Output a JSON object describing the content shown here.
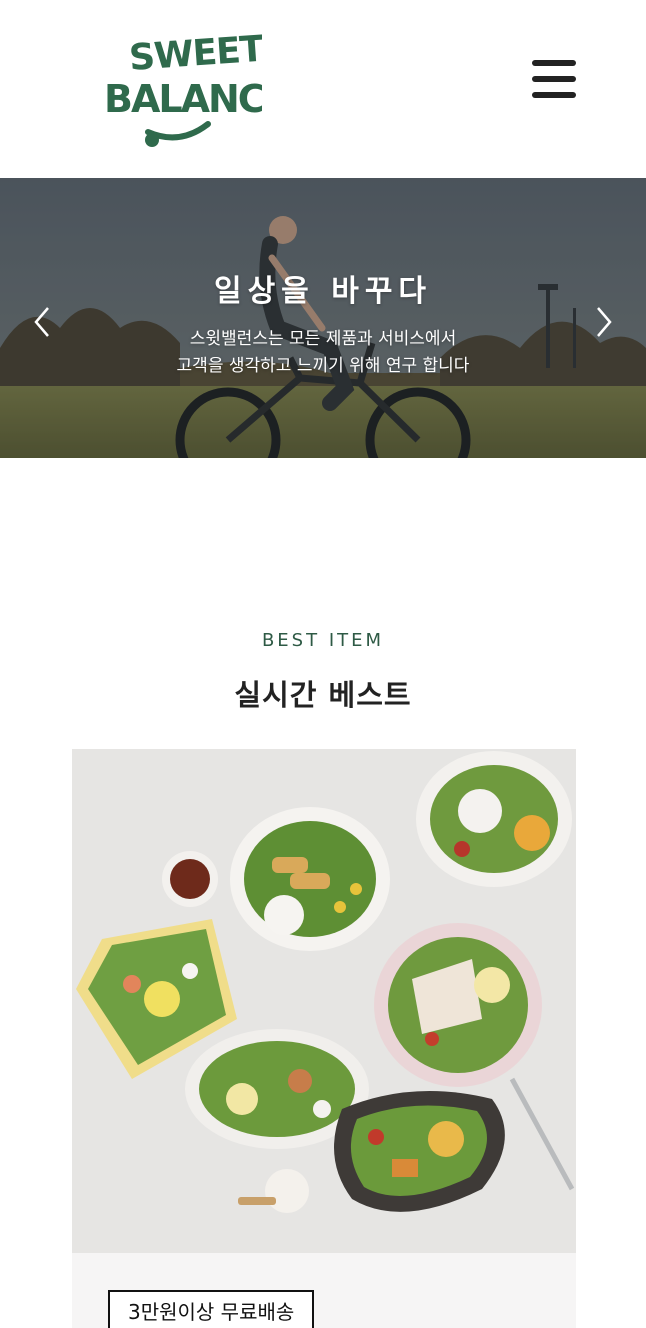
{
  "header": {
    "logo": {
      "line1": "SWEET",
      "line2": "BALANCE"
    },
    "menu_icon": "hamburger-icon"
  },
  "hero": {
    "title": "일상을 바꾸다",
    "description": [
      "스윗밸런스는 모든 제품과 서비스에서",
      "고객을 생각하고 느끼기 위해 연구 합니다"
    ],
    "prev_icon": "chevron-left-icon",
    "next_icon": "chevron-right-icon"
  },
  "best": {
    "label": "BEST  ITEM",
    "title": "실시간 베스트"
  },
  "product": {
    "badge": "3만원이상 무료배송"
  },
  "colors": {
    "brand_green": "#2e5a45",
    "logo_green": "#2f6a4c"
  }
}
